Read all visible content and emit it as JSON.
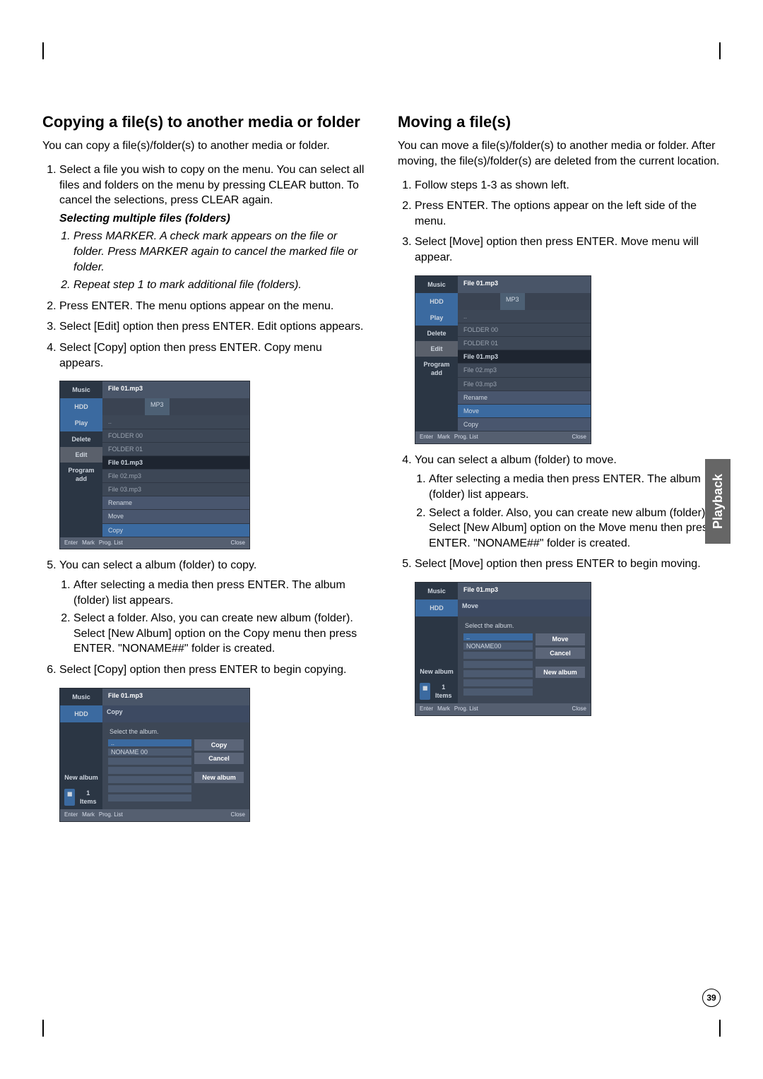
{
  "sidetab": "Playback",
  "page_number": "39",
  "left": {
    "heading": "Copying a file(s) to another media or folder",
    "intro": "You can copy a file(s)/folder(s) to another media or folder.",
    "steps": {
      "s1": "Select a file you wish to copy on the menu. You can select all files and folders on the menu by pressing CLEAR button. To cancel the selections, press CLEAR again.",
      "sub_heading": "Selecting multiple files (folders)",
      "sub1": "Press MARKER. A check mark appears on the file or folder. Press MARKER again to cancel the marked file or folder.",
      "sub2": "Repeat step 1 to mark additional file (folders).",
      "s2": "Press ENTER. The menu options appear on the menu.",
      "s3": "Select [Edit] option then press ENTER. Edit options appears.",
      "s4": "Select [Copy] option then press ENTER. Copy menu appears.",
      "s5": "You can select a album (folder) to copy.",
      "s5a": "After selecting a media then press ENTER. The album (folder) list appears.",
      "s5b": "Select a folder. Also, you can create new album (folder). Select [New Album] option on the Copy menu then press ENTER. \"NONAME##\" folder is created.",
      "s6": "Select [Copy] option then press ENTER to begin copying."
    },
    "shot1": {
      "music": "Music",
      "hdd": "HDD",
      "file_hdr": "File 01.mp3",
      "mp3": "MP3",
      "up": "..",
      "folder00": "FOLDER 00",
      "folder01": "FOLDER 01",
      "f1": "File 01.mp3",
      "f2": "File 02.mp3",
      "f3": "File 03.mp3",
      "side_play": "Play",
      "side_delete": "Delete",
      "side_edit": "Edit",
      "side_prog": "Program add",
      "ctx_rename": "Rename",
      "ctx_move": "Move",
      "ctx_copy": "Copy",
      "foot_enter": "Enter",
      "foot_mark": "Mark",
      "foot_prog": "Prog. List",
      "foot_close": "Close"
    },
    "shot2": {
      "music": "Music",
      "hdd": "HDD",
      "file_hdr": "File 01.mp3",
      "title": "Copy",
      "caption": "Select the album.",
      "up": "..",
      "noname": "NONAME 00",
      "btn_copy": "Copy",
      "btn_cancel": "Cancel",
      "btn_new": "New album",
      "side_new": "New album",
      "items": "1 Items",
      "foot_enter": "Enter",
      "foot_mark": "Mark",
      "foot_prog": "Prog. List",
      "foot_close": "Close"
    }
  },
  "right": {
    "heading": "Moving a file(s)",
    "intro": "You can move a file(s)/folder(s) to another media or folder. After moving, the file(s)/folder(s) are deleted from the current location.",
    "steps": {
      "s1": "Follow steps 1-3 as shown left.",
      "s2": "Press ENTER. The options appear on the left side of the menu.",
      "s3": "Select [Move] option then press ENTER. Move menu will appear.",
      "s4": "You can select a album (folder) to move.",
      "s4a": "After selecting a media then press ENTER. The album (folder) list appears.",
      "s4b": "Select a folder. Also, you can create new album (folder). Select [New Album] option on the Move menu then press ENTER. \"NONAME##\" folder is created.",
      "s5": "Select [Move] option then press ENTER to begin moving."
    },
    "shot1": {
      "music": "Music",
      "hdd": "HDD",
      "file_hdr": "File 01.mp3",
      "mp3": "MP3",
      "up": "..",
      "folder00": "FOLDER 00",
      "folder01": "FOLDER 01",
      "f1": "File 01.mp3",
      "f2": "File 02.mp3",
      "f3": "File 03.mp3",
      "side_play": "Play",
      "side_delete": "Delete",
      "side_edit": "Edit",
      "side_prog": "Program add",
      "ctx_rename": "Rename",
      "ctx_move": "Move",
      "ctx_copy": "Copy",
      "foot_enter": "Enter",
      "foot_mark": "Mark",
      "foot_prog": "Prog. List",
      "foot_close": "Close"
    },
    "shot2": {
      "music": "Music",
      "hdd": "HDD",
      "file_hdr": "File 01.mp3",
      "title": "Move",
      "caption": "Select the album.",
      "up": "..",
      "noname": "NONAME00",
      "btn_move": "Move",
      "btn_cancel": "Cancel",
      "btn_new": "New album",
      "side_new": "New album",
      "items": "1 Items",
      "foot_enter": "Enter",
      "foot_mark": "Mark",
      "foot_prog": "Prog. List",
      "foot_close": "Close"
    }
  }
}
